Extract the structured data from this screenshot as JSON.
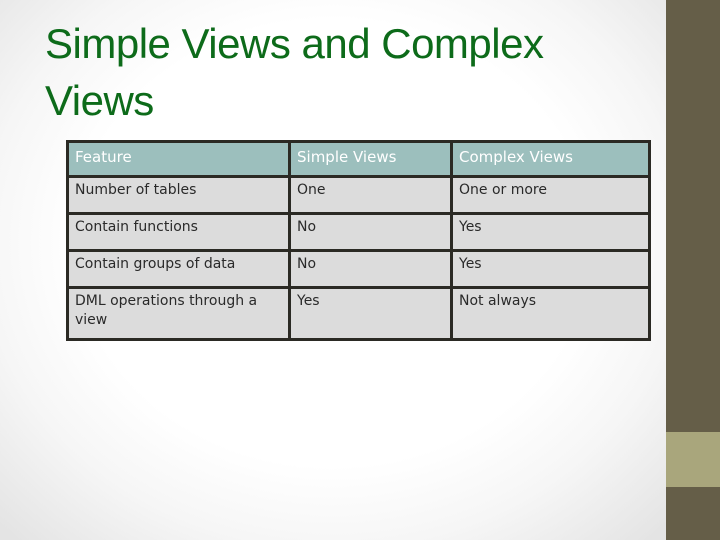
{
  "slide": {
    "title": "Simple Views and Complex Views",
    "colors": {
      "title": "#0d6b1a",
      "side_bar": "#655e48",
      "side_accent": "#a9a67c",
      "header_fill": "#9cbfbd",
      "cell_fill": "#dcdcdc",
      "border": "#2b2a24"
    }
  },
  "table": {
    "headers": [
      "Feature",
      "Simple Views",
      "Complex Views"
    ],
    "rows": [
      [
        "Number of tables",
        "One",
        "One or more"
      ],
      [
        "Contain functions",
        "No",
        "Yes"
      ],
      [
        "Contain groups of data",
        "No",
        "Yes"
      ],
      [
        "DML operations through a view",
        "Yes",
        "Not always"
      ]
    ]
  }
}
